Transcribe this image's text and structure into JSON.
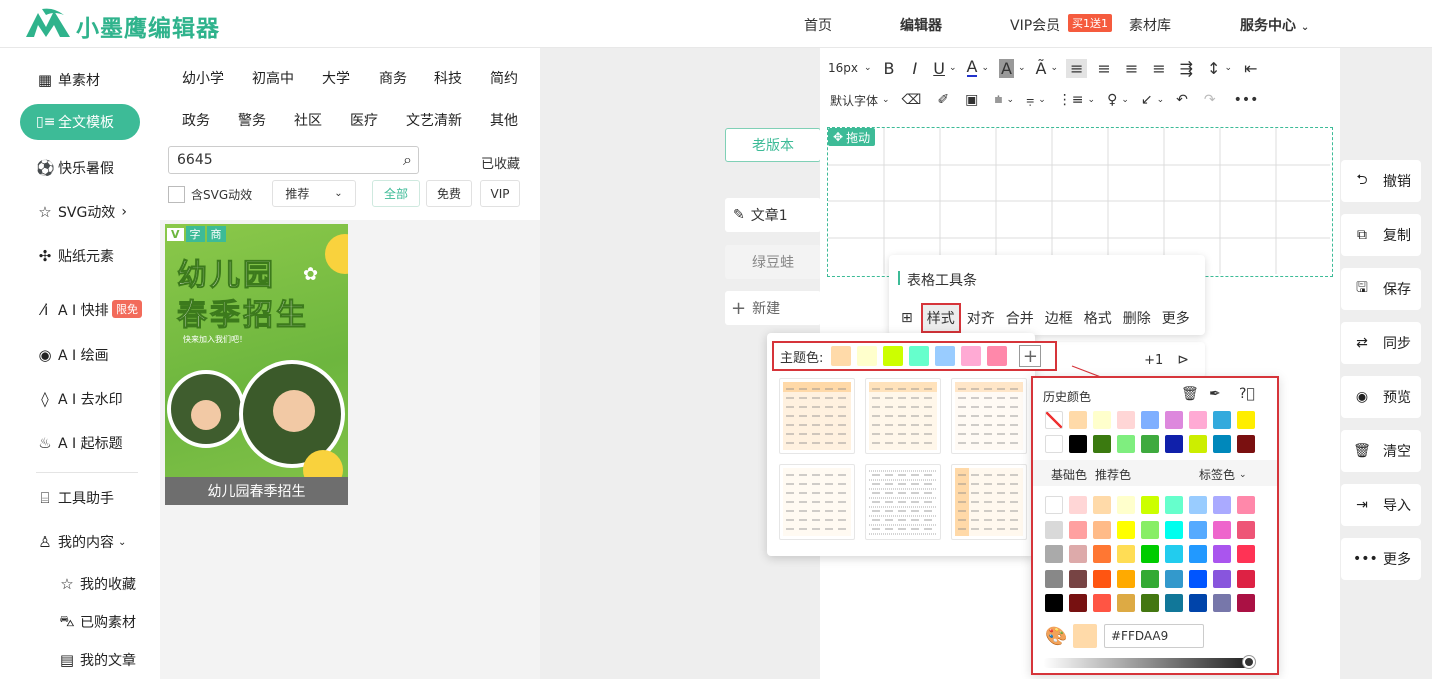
{
  "header": {
    "logo_text": "小墨鹰编辑器",
    "nav": [
      "首页",
      "编辑器",
      "VIP会员",
      "素材库",
      "服务中心"
    ],
    "vip_badge": "买1送1"
  },
  "leftnav": {
    "items": [
      {
        "label": "单素材",
        "icon": "grid-icon"
      },
      {
        "label": "全文模板",
        "icon": "template-icon"
      },
      {
        "label": "快乐暑假",
        "icon": "ball-icon"
      },
      {
        "label": "SVG动效",
        "icon": "star-outline-icon"
      },
      {
        "label": "贴纸元素",
        "icon": "puzzle-icon"
      },
      {
        "label": "A I 快排",
        "icon": "ai-icon",
        "badge": "限免"
      },
      {
        "label": "A I 绘画",
        "icon": "palette-icon"
      },
      {
        "label": "A I 去水印",
        "icon": "drop-icon"
      },
      {
        "label": "A I 起标题",
        "icon": "flame-icon"
      },
      {
        "label": "工具助手",
        "icon": "ruler-icon"
      },
      {
        "label": "我的内容",
        "icon": "user-icon"
      },
      {
        "label": "我的收藏",
        "icon": "star-icon"
      },
      {
        "label": "已购素材",
        "icon": "cart-icon"
      },
      {
        "label": "我的文章",
        "icon": "doc-icon"
      }
    ]
  },
  "categories": {
    "row1": [
      "幼小学",
      "初高中",
      "大学",
      "商务",
      "科技",
      "简约"
    ],
    "row2": [
      "政务",
      "警务",
      "社区",
      "医疗",
      "文艺清新",
      "其他"
    ]
  },
  "search": {
    "value": "6645",
    "favorites": "已收藏"
  },
  "filters": {
    "svg_label": "含SVG动效",
    "sort": "推荐",
    "pills": [
      "全部",
      "免费",
      "VIP"
    ]
  },
  "card": {
    "tags": [
      "V",
      "字",
      "商"
    ],
    "title_l1": "幼儿园",
    "title_l2": "春季招生",
    "subtitle": "快来加入我们吧！",
    "caption": "幼儿园春季招生"
  },
  "editor": {
    "font_size": "16px",
    "font_family": "默认字体",
    "drag_tag": "拖动",
    "old_version": "老版本",
    "article": "文章1",
    "item2": "绿豆蛙",
    "new_label": "新建"
  },
  "actions": [
    {
      "label": "撤销",
      "icon": "undo-icon"
    },
    {
      "label": "复制",
      "icon": "copy-icon"
    },
    {
      "label": "保存",
      "icon": "save-icon"
    },
    {
      "label": "同步",
      "icon": "sync-icon"
    },
    {
      "label": "预览",
      "icon": "eye-icon"
    },
    {
      "label": "清空",
      "icon": "trash-icon"
    },
    {
      "label": "导入",
      "icon": "import-icon"
    },
    {
      "label": "更多",
      "icon": "more-icon"
    }
  ],
  "table_toolbar": {
    "title": "表格工具条",
    "items": [
      "样式",
      "对齐",
      "合并",
      "边框",
      "格式",
      "删除",
      "更多"
    ],
    "counter": "+1"
  },
  "style_popup": {
    "theme_label": "主题色:",
    "theme_colors": [
      "#FFDAA9",
      "#FFFFCC",
      "#CCFF00",
      "#66FFCC",
      "#99CCFF",
      "#FFAAD4",
      "#FF88AA"
    ]
  },
  "color_picker": {
    "history_label": "历史颜色",
    "history": [
      [
        "none",
        "#FFDAA9",
        "#FFFFCC",
        "#FFD6D6",
        "#7FAFFF",
        "#DD88DD",
        "#FFAAD4",
        "#33AADD",
        "#FFEE00"
      ],
      [
        "#FFFFFF",
        "#000000",
        "#3B7A10",
        "#7FEE7F",
        "#3FAA3F",
        "#1020AA",
        "#CCEE00",
        "#0088BB",
        "#7A1010"
      ]
    ],
    "tabs": [
      "基础色",
      "推荐色",
      "标签色"
    ],
    "grid": [
      [
        "#FFFFFF",
        "#FFD6D6",
        "#FFDAA9",
        "#FFFFCC",
        "#CCFF00",
        "#66FFCC",
        "#99CCFF",
        "#AAAAFF",
        "#FF88AA"
      ],
      [
        "#D9D9D9",
        "#FFA0A0",
        "#FFBB88",
        "#FFFF00",
        "#88EE66",
        "#00FFEE",
        "#55AAFF",
        "#EE66CC",
        "#EE5577"
      ],
      [
        "#AAAAAA",
        "#DDAAAA",
        "#FF7733",
        "#FFDD55",
        "#00CC00",
        "#22CCEE",
        "#2299FF",
        "#AA55EE",
        "#FF3355"
      ],
      [
        "#888888",
        "#774444",
        "#FF5511",
        "#FFAA00",
        "#33AA33",
        "#3399CC",
        "#0055FF",
        "#8855DD",
        "#DD2244"
      ],
      [
        "#000000",
        "#771111",
        "#FF5544",
        "#DDAA44",
        "#447711",
        "#117799",
        "#0044AA",
        "#7777AA",
        "#AA1144"
      ]
    ],
    "current_color": "#FFDAA9",
    "hex_value": "#FFDAA9"
  }
}
